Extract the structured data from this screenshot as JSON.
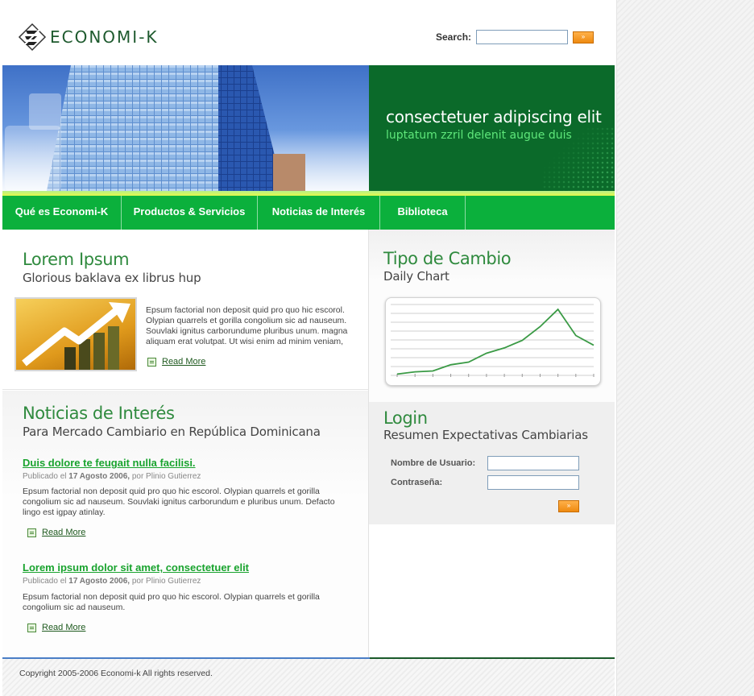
{
  "header": {
    "brand": "ECONOMI-K",
    "search_label": "Search:",
    "search_value": "",
    "search_button": "»"
  },
  "banner": {
    "title": "consectetuer adipiscing elit",
    "subtitle": "luptatum zzril delenit augue duis"
  },
  "nav": {
    "items": [
      {
        "label": "Qué es Economi-K"
      },
      {
        "label": "Productos & Servicios"
      },
      {
        "label": "Noticias de Interés"
      },
      {
        "label": "Biblioteca"
      }
    ]
  },
  "lorem": {
    "title": "Lorem Ipsum",
    "subtitle": "Glorious baklava ex librus hup",
    "body": "Epsum factorial non deposit quid pro quo hic escorol. Olypian quarrels et gorilla congolium sic ad nauseum. Souvlaki ignitus carborundume pluribus unum. magna aliquam erat volutpat. Ut wisi enim ad minim veniam,",
    "read_more": "Read More"
  },
  "noticias": {
    "title": "Noticias de Interés",
    "subtitle": "Para Mercado Cambiario en República Dominicana",
    "items": [
      {
        "title": "Duis dolore te feugait nulla facilisi.",
        "meta_prefix": "Publicado el",
        "date": "17 Agosto 2006,",
        "meta_suffix": "por Plinio Gutierrez",
        "body": "Epsum factorial non deposit quid pro quo hic escorol. Olypian quarrels et gorilla congolium sic ad nauseum. Souvlaki ignitus carborundum e pluribus unum. Defacto lingo est igpay atinlay.",
        "read_more": "Read More"
      },
      {
        "title": "Lorem ipsum dolor sit amet, consectetuer elit",
        "meta_prefix": "Publicado el",
        "date": "17 Agosto 2006,",
        "meta_suffix": "por Plinio Gutierrez",
        "body": "Epsum factorial non deposit quid pro quo hic escorol. Olypian quarrels et gorilla congolium sic ad nauseum.",
        "read_more": "Read More"
      }
    ]
  },
  "tipo": {
    "title": "Tipo de Cambio",
    "subtitle": "Daily Chart"
  },
  "chart_data": {
    "type": "line",
    "title": "",
    "xlabel": "",
    "ylabel": "",
    "x": [
      1,
      2,
      3,
      4,
      5,
      6,
      7,
      8,
      9,
      10,
      11,
      12
    ],
    "series": [
      {
        "values": [
          0.3,
          0.8,
          1.0,
          2.4,
          3.0,
          5.0,
          6.2,
          7.9,
          11.0,
          14.9,
          9.0,
          6.8
        ]
      }
    ],
    "ylim": [
      0,
      16
    ],
    "grid": true,
    "colors": {
      "line": "#3a9a45",
      "grid": "#cfcfcf"
    }
  },
  "login": {
    "title": "Login",
    "subtitle": "Resumen Expectativas Cambiarias",
    "user_label": "Nombre de Usuario:",
    "pass_label": "Contraseña:",
    "user_value": "",
    "pass_value": "",
    "submit": "»"
  },
  "footer": {
    "copyright": "Copyright 2005-2006 Economi-k All rights reserved."
  },
  "colors": {
    "brand_green": "#0bb03c",
    "dark_green": "#0b6a2a",
    "heading_green": "#2f8a3e",
    "news_link": "#19a32e",
    "button_orange": "#ee8a10"
  }
}
